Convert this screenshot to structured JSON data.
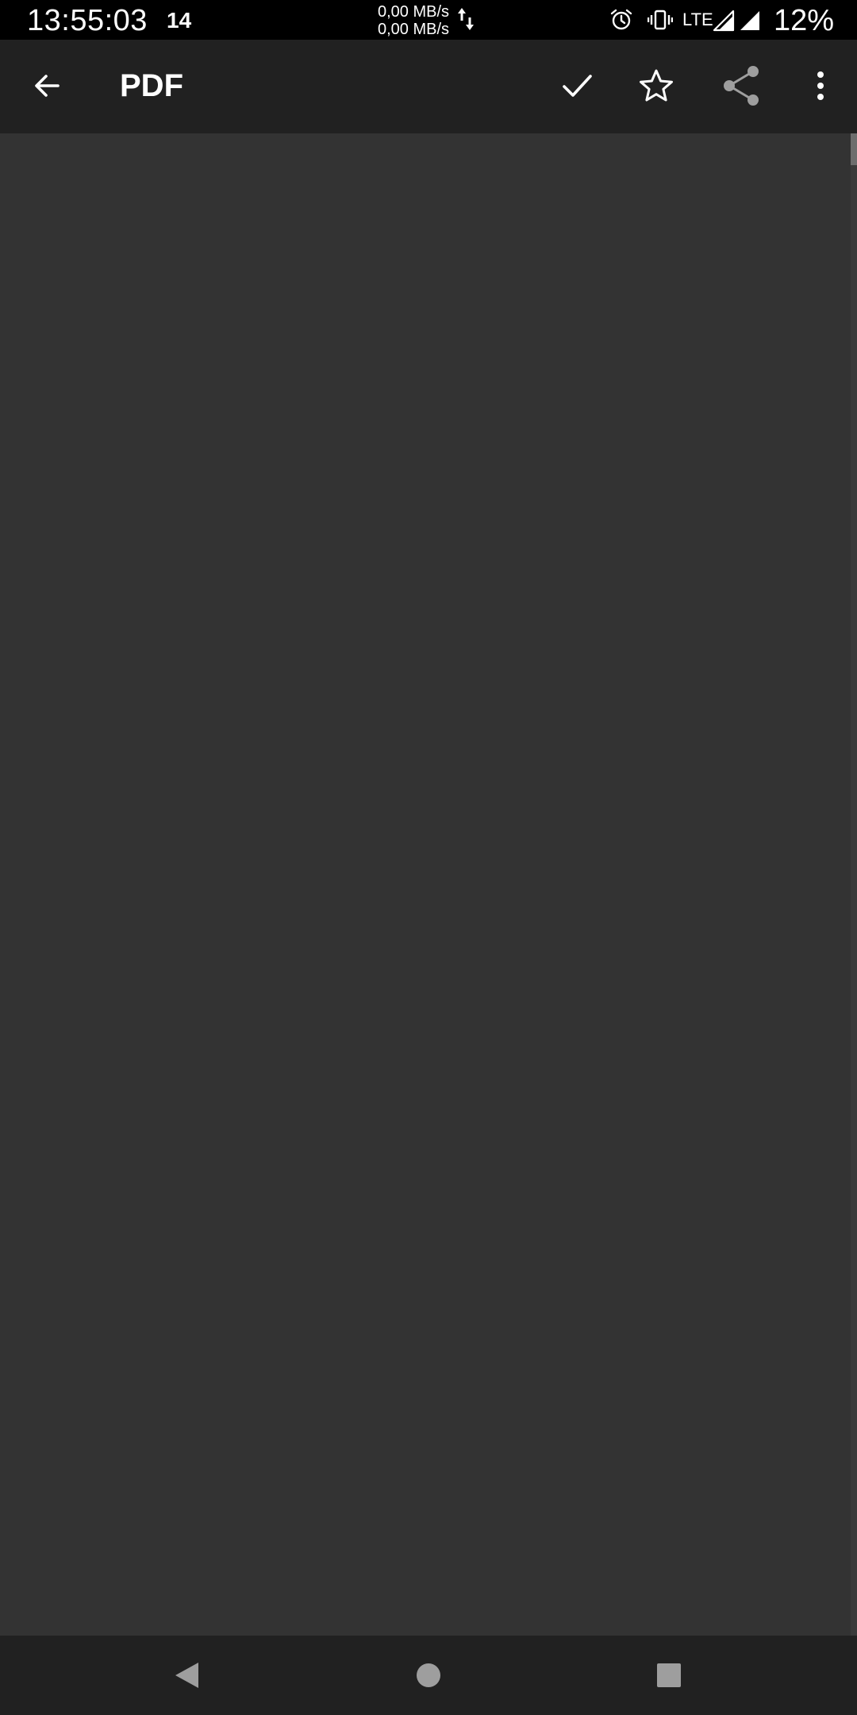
{
  "status_bar": {
    "time": "13:55:03",
    "notification_count": "14",
    "net_speed_up": "0,00 MB/s",
    "net_speed_down": "0,00 MB/s",
    "network_type": "LTE",
    "battery": "12%",
    "icons": [
      "data-transfer-icon",
      "alarm-icon",
      "vibrate-icon",
      "signal-icon",
      "signal-icon"
    ]
  },
  "app_bar": {
    "title": "PDF",
    "icons": {
      "back": "arrow-back-icon",
      "check": "check-icon",
      "favorite": "star-outline-icon",
      "share": "share-icon",
      "more": "more-vert-icon"
    }
  },
  "content": {
    "scroll_position": 0
  },
  "nav_bar": {
    "icons": [
      "nav-back-icon",
      "nav-home-icon",
      "nav-recents-icon"
    ]
  },
  "colors": {
    "status_bar_bg": "#000000",
    "app_bar_bg": "#212121",
    "content_bg": "#333333",
    "nav_bar_bg": "#212121",
    "icon_white": "#ffffff",
    "icon_disabled": "#9e9e9e",
    "nav_icon": "#9e9e9e"
  }
}
